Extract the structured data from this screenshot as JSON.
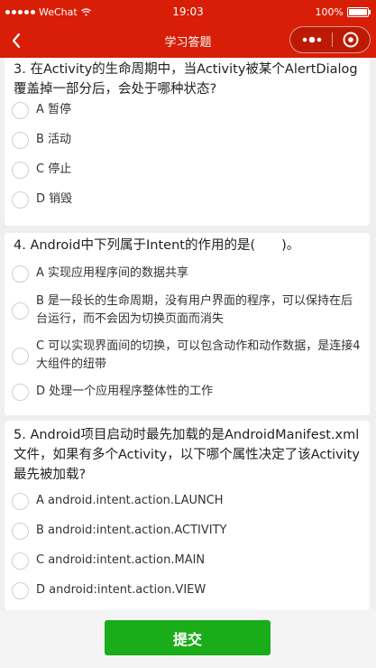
{
  "status_bar": {
    "carrier": "WeChat",
    "time": "19:03",
    "battery": "100%"
  },
  "nav": {
    "title": "学习答题"
  },
  "questions": [
    {
      "text": "3. 在Activity的生命周期中，当Activity被某个AlertDialog覆盖掉一部分后，会处于哪种状态?",
      "options": [
        "A 暂停",
        "B 活动",
        "C 停止",
        "D 销毁"
      ]
    },
    {
      "text": "4. Android中下列属于Intent的作用的是(　　)。",
      "options": [
        "A 实现应用程序间的数据共享",
        "B 是一段长的生命周期，没有用户界面的程序，可以保持在后台运行，而不会因为切换页面而消失",
        "C 可以实现界面间的切换，可以包含动作和动作数据，是连接4大组件的纽带",
        "D 处理一个应用程序整体性的工作"
      ]
    },
    {
      "text": "5. Android项目启动时最先加载的是AndroidManifest.xml文件，如果有多个Activity，以下哪个属性决定了该Activity最先被加载?",
      "options": [
        "A android.intent.action.LAUNCH",
        "B android:intent.action.ACTIVITY",
        "C android:intent.action.MAIN",
        "D android:intent.action.VIEW"
      ]
    }
  ],
  "footer": {
    "submit_label": "提交"
  }
}
